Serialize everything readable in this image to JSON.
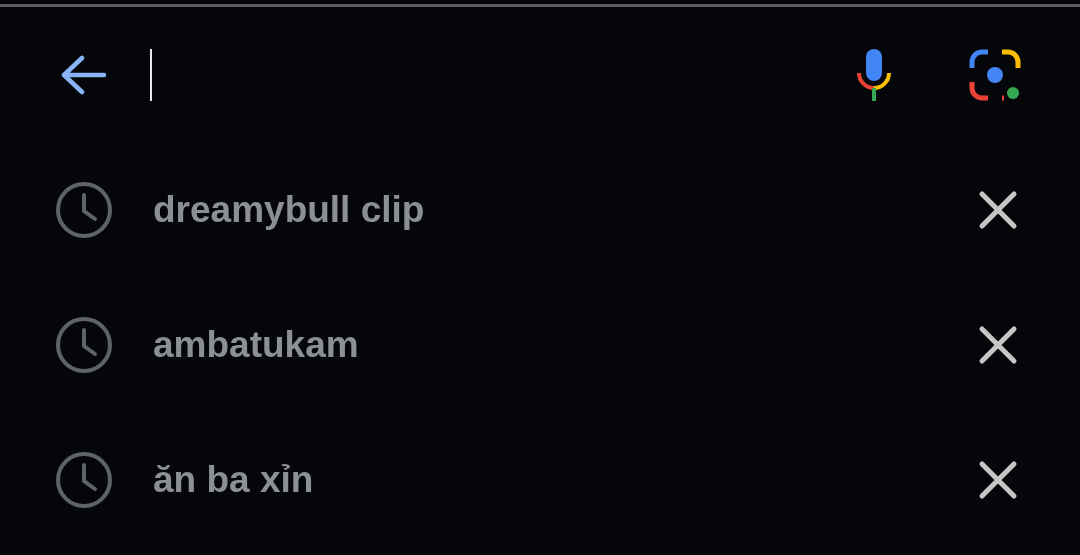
{
  "history": [
    {
      "query": "dreamybull clip"
    },
    {
      "query": "ambatukam"
    },
    {
      "query": "ăn ba xỉn"
    }
  ]
}
